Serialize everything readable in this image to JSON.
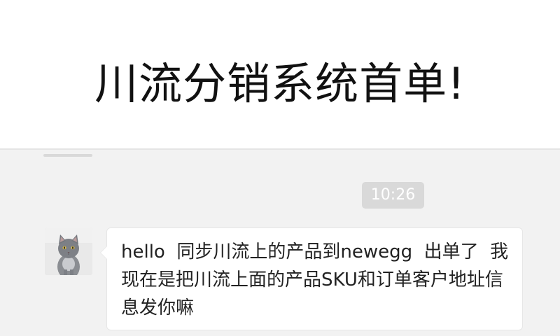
{
  "headline": {
    "text": "川流分销系统首单!"
  },
  "chat": {
    "timestamp": "10:26",
    "message": {
      "text": "hello  同步川流上的产品到newegg  出单了  我现在是把川流上面的产品SKU和订单客户地址信息发你嘛"
    },
    "avatar": {
      "icon": "cat-avatar-icon"
    }
  }
}
